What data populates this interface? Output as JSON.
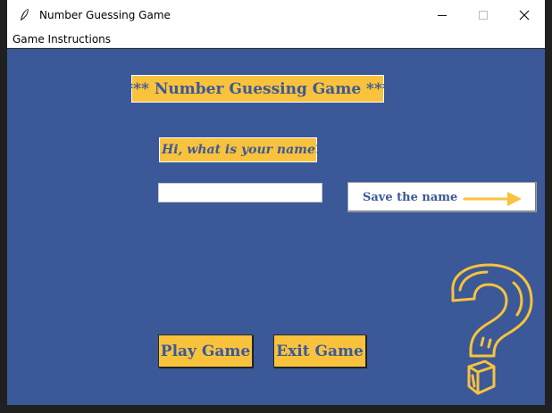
{
  "window": {
    "title": "Number Guessing Game",
    "icon": "feather-icon",
    "controls": [
      "minimize-icon",
      "maximize-icon",
      "close-icon"
    ]
  },
  "menubar": {
    "items": [
      {
        "label": "Game Instructions"
      }
    ]
  },
  "main": {
    "banner_title": "*** Number Guessing Game ***",
    "name_prompt": "Hi, what is your name?",
    "name_input": {
      "value": "",
      "placeholder": ""
    },
    "save_button_label": "Save the name",
    "save_button_icon": "arrow-right-icon",
    "play_button_label": "Play Game",
    "exit_button_label": "Exit Game",
    "decoration_icon": "question-mark-icon"
  },
  "colors": {
    "background": "#3b5998",
    "accent": "#f9c23c",
    "text": "#3b5998"
  }
}
